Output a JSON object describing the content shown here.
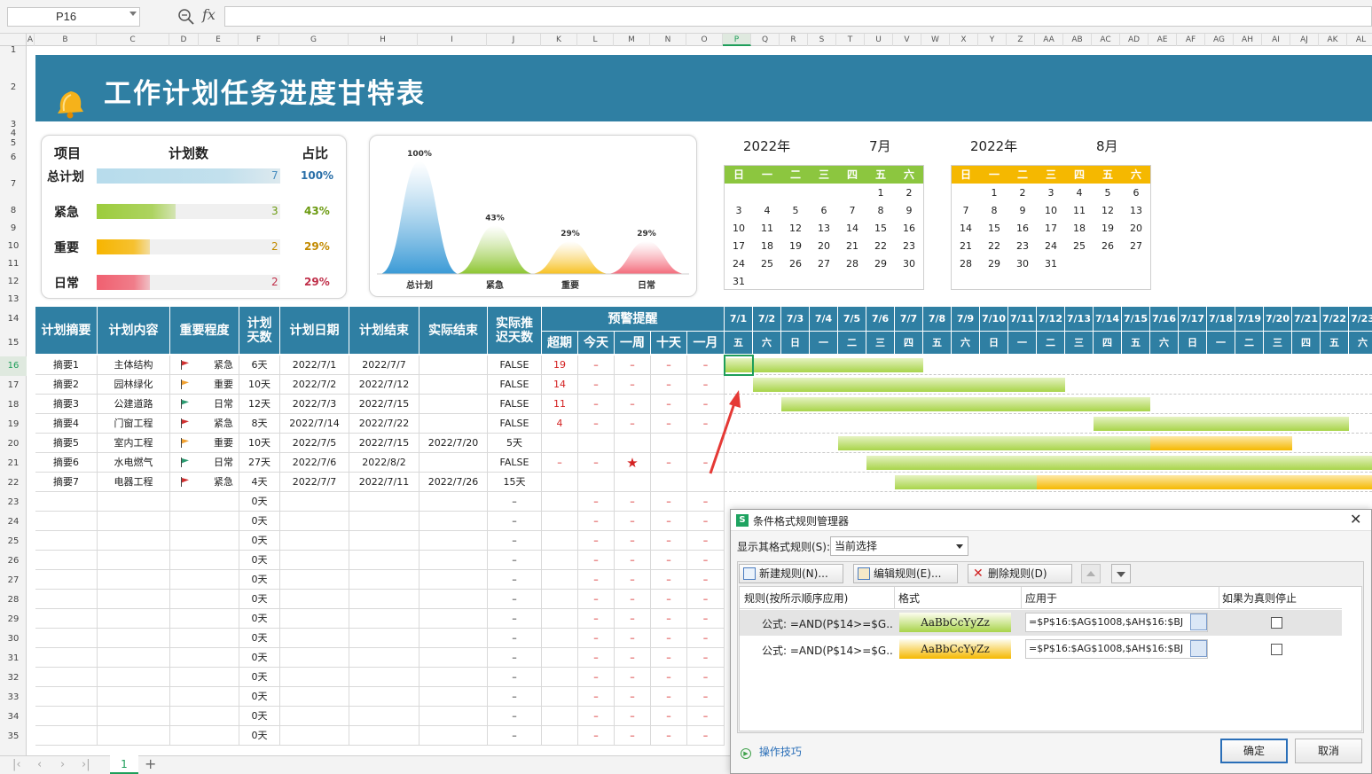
{
  "formula_bar": {
    "cell_ref": "P16",
    "fx": "fx",
    "formula": ""
  },
  "columns": [
    "A",
    "B",
    "C",
    "D",
    "E",
    "F",
    "G",
    "H",
    "I",
    "J",
    "K",
    "L",
    "M",
    "N",
    "O",
    "P",
    "Q",
    "R",
    "S",
    "T",
    "U",
    "V",
    "W",
    "X",
    "Y",
    "Z",
    "AA",
    "AB",
    "AC",
    "AD",
    "AE",
    "AF",
    "AG",
    "AH",
    "AI",
    "AJ",
    "AK",
    "AL"
  ],
  "rows": [
    "1",
    "2",
    "3",
    "4",
    "5",
    "6",
    "7",
    "8",
    "9",
    "10",
    "11",
    "12",
    "13",
    "14",
    "15",
    "16",
    "17",
    "18",
    "19",
    "20",
    "21",
    "22",
    "23",
    "24",
    "25",
    "26",
    "27",
    "28",
    "29",
    "30",
    "31",
    "32",
    "33",
    "34",
    "35"
  ],
  "title": "工作计划任务进度甘特表",
  "summary": {
    "headers": {
      "item": "项目",
      "count": "计划数",
      "ratio": "占比"
    },
    "rows": [
      {
        "label": "总计划",
        "count": "7",
        "pct": "100%",
        "fraction": 1.0,
        "color": "#b7dcec",
        "numcolor": "#4a8fc0",
        "pctcolor": "#2a6fa8"
      },
      {
        "label": "紧急",
        "count": "3",
        "pct": "43%",
        "fraction": 0.43,
        "color": "#9ccc3c",
        "numcolor": "#6b9a10",
        "pctcolor": "#6b9a10"
      },
      {
        "label": "重要",
        "count": "2",
        "pct": "29%",
        "fraction": 0.29,
        "color": "#f7b500",
        "numcolor": "#c28a00",
        "pctcolor": "#c28a00"
      },
      {
        "label": "日常",
        "count": "2",
        "pct": "29%",
        "fraction": 0.29,
        "color": "#f06070",
        "numcolor": "#c0304a",
        "pctcolor": "#c0304a"
      }
    ]
  },
  "chart_data": {
    "type": "area",
    "categories": [
      "总计划",
      "紧急",
      "重要",
      "日常"
    ],
    "values": [
      100,
      43,
      29,
      29
    ],
    "labels": [
      "100%",
      "43%",
      "29%",
      "29%"
    ],
    "colors": [
      "#3a9ad6",
      "#8cc530",
      "#f7c020",
      "#f36a7a"
    ],
    "title": "",
    "ylim": [
      0,
      100
    ]
  },
  "calendars": [
    {
      "year": "2022年",
      "month": "7月",
      "header_color": "#8cc63f",
      "weekdays": [
        "日",
        "一",
        "二",
        "三",
        "四",
        "五",
        "六"
      ],
      "weeks": [
        [
          "",
          "",
          "",
          "",
          "",
          "1",
          "2"
        ],
        [
          "3",
          "4",
          "5",
          "6",
          "7",
          "8",
          "9"
        ],
        [
          "10",
          "11",
          "12",
          "13",
          "14",
          "15",
          "16"
        ],
        [
          "17",
          "18",
          "19",
          "20",
          "21",
          "22",
          "23"
        ],
        [
          "24",
          "25",
          "26",
          "27",
          "28",
          "29",
          "30"
        ],
        [
          "31",
          "",
          "",
          "",
          "",
          "",
          ""
        ]
      ]
    },
    {
      "year": "2022年",
      "month": "8月",
      "header_color": "#f5b800",
      "weekdays": [
        "日",
        "一",
        "二",
        "三",
        "四",
        "五",
        "六"
      ],
      "weeks": [
        [
          "",
          "1",
          "2",
          "3",
          "4",
          "5",
          "6"
        ],
        [
          "7",
          "8",
          "9",
          "10",
          "11",
          "12",
          "13"
        ],
        [
          "14",
          "15",
          "16",
          "17",
          "18",
          "19",
          "20"
        ],
        [
          "21",
          "22",
          "23",
          "24",
          "25",
          "26",
          "27"
        ],
        [
          "28",
          "29",
          "30",
          "31",
          "",
          "",
          ""
        ]
      ]
    }
  ],
  "table": {
    "headers": {
      "summary": "计划摘要",
      "content": "计划内容",
      "level": "重要程度",
      "days": "计划\n天数",
      "start": "计划日期",
      "end": "计划结束",
      "actual": "实际结束",
      "delay": "实际推\n迟天数",
      "alert": "预警提醒",
      "overdue": "超期",
      "today": "今天",
      "week": "一周",
      "ten": "十天",
      "month": "一月"
    },
    "gantt_dates": [
      "7/1",
      "7/2",
      "7/3",
      "7/4",
      "7/5",
      "7/6",
      "7/7",
      "7/8",
      "7/9",
      "7/10",
      "7/11",
      "7/12",
      "7/13",
      "7/14",
      "7/15",
      "7/16",
      "7/17",
      "7/18",
      "7/19",
      "7/20",
      "7/21",
      "7/22",
      "7/23"
    ],
    "gantt_weekdays": [
      "五",
      "六",
      "日",
      "一",
      "二",
      "三",
      "四",
      "五",
      "六",
      "日",
      "一",
      "二",
      "三",
      "四",
      "五",
      "六",
      "日",
      "一",
      "二",
      "三",
      "四",
      "五",
      "六"
    ],
    "rows": [
      {
        "summary": "摘要1",
        "content": "主体结构",
        "level": "紧急",
        "flag": "#d03030",
        "days": "6天",
        "start": "2022/7/1",
        "end": "2022/7/7",
        "actual": "",
        "delay": "FALSE",
        "overdue": "19",
        "today": "–",
        "week": "–",
        "ten": "–",
        "month": "–"
      },
      {
        "summary": "摘要2",
        "content": "园林绿化",
        "level": "重要",
        "flag": "#f0a030",
        "days": "10天",
        "start": "2022/7/2",
        "end": "2022/7/12",
        "actual": "",
        "delay": "FALSE",
        "overdue": "14",
        "today": "–",
        "week": "–",
        "ten": "–",
        "month": "–"
      },
      {
        "summary": "摘要3",
        "content": "公建道路",
        "level": "日常",
        "flag": "#2a9a70",
        "days": "12天",
        "start": "2022/7/3",
        "end": "2022/7/15",
        "actual": "",
        "delay": "FALSE",
        "overdue": "11",
        "today": "–",
        "week": "–",
        "ten": "–",
        "month": "–"
      },
      {
        "summary": "摘要4",
        "content": "门窗工程",
        "level": "紧急",
        "flag": "#d03030",
        "days": "8天",
        "start": "2022/7/14",
        "end": "2022/7/22",
        "actual": "",
        "delay": "FALSE",
        "overdue": "4",
        "today": "–",
        "week": "–",
        "ten": "–",
        "month": "–"
      },
      {
        "summary": "摘要5",
        "content": "室内工程",
        "level": "重要",
        "flag": "#f0a030",
        "days": "10天",
        "start": "2022/7/5",
        "end": "2022/7/15",
        "actual": "2022/7/20",
        "delay": "5天",
        "overdue": "",
        "today": "",
        "week": "",
        "ten": "",
        "month": ""
      },
      {
        "summary": "摘要6",
        "content": "水电燃气",
        "level": "日常",
        "flag": "#2a9a70",
        "days": "27天",
        "start": "2022/7/6",
        "end": "2022/8/2",
        "actual": "",
        "delay": "FALSE",
        "overdue": "–",
        "today": "–",
        "week": "★",
        "ten": "–",
        "month": "–"
      },
      {
        "summary": "摘要7",
        "content": "电器工程",
        "level": "紧急",
        "flag": "#d03030",
        "days": "4天",
        "start": "2022/7/7",
        "end": "2022/7/11",
        "actual": "2022/7/26",
        "delay": "15天",
        "overdue": "",
        "today": "",
        "week": "",
        "ten": "",
        "month": ""
      }
    ],
    "empty_rows": {
      "days": "0天",
      "delay": "–",
      "dash": "–",
      "count": 13
    },
    "gantt_bars": [
      {
        "start": 0,
        "green": 7,
        "orange": 0
      },
      {
        "start": 1,
        "green": 11,
        "orange": 0
      },
      {
        "start": 2,
        "green": 13,
        "orange": 0
      },
      {
        "start": 13,
        "green": 9,
        "orange": 0
      },
      {
        "start": 4,
        "green": 11,
        "orange": 5
      },
      {
        "start": 5,
        "green": 28,
        "orange": 0
      },
      {
        "start": 6,
        "green": 5,
        "orange": 20
      }
    ]
  },
  "dialog": {
    "title": "条件格式规则管理器",
    "show_label": "显示其格式规则(S):",
    "show_value": "当前选择",
    "new_rule": "新建规则(N)...",
    "edit_rule": "编辑规则(E)...",
    "delete_rule": "删除规则(D)",
    "col_rule": "规则(按所示顺序应用)",
    "col_format": "格式",
    "col_apply": "应用于",
    "col_stop": "如果为真则停止",
    "rules": [
      {
        "rule": "公式: =AND(P$14>=$G..",
        "preview": "AaBbCcYyZz",
        "color": "#a8d44a",
        "apply": "=$P$16:$AG$1008,$AH$16:$BJ"
      },
      {
        "rule": "公式: =AND(P$14>=$G..",
        "preview": "AaBbCcYyZz",
        "color": "#f5b800",
        "apply": "=$P$16:$AG$1008,$AH$16:$BJ"
      }
    ],
    "tips": "操作技巧",
    "ok": "确定",
    "cancel": "取消"
  },
  "sheet_tab": "1",
  "add_sheet": "+"
}
